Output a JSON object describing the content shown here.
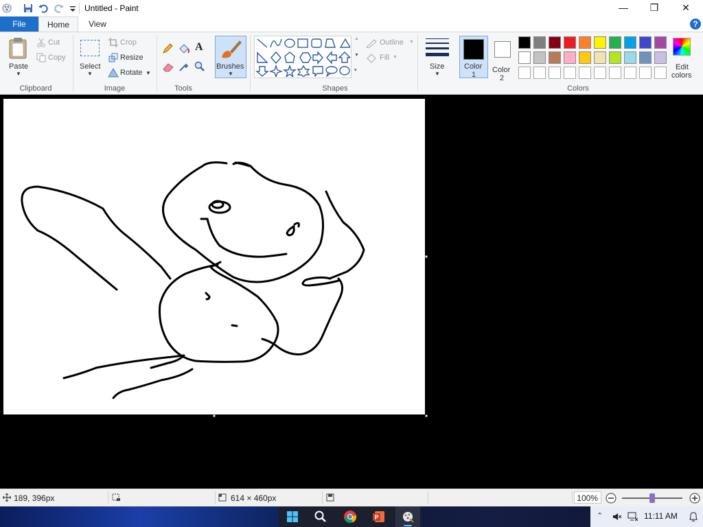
{
  "window": {
    "title": "Untitled - Paint",
    "controls": {
      "minimize": "—",
      "maximize": "❐",
      "close": "✕"
    }
  },
  "tabs": {
    "file": "File",
    "home": "Home",
    "view": "View"
  },
  "ribbon": {
    "clipboard": {
      "label": "Clipboard",
      "paste": "Paste",
      "cut": "Cut",
      "copy": "Copy"
    },
    "image": {
      "label": "Image",
      "select": "Select",
      "crop": "Crop",
      "resize": "Resize",
      "rotate": "Rotate"
    },
    "tools": {
      "label": "Tools",
      "text_glyph": "A"
    },
    "brushes": {
      "label": "Brushes"
    },
    "shapes": {
      "label": "Shapes",
      "outline": "Outline",
      "fill": "Fill"
    },
    "size": {
      "label": "Size"
    },
    "color1": {
      "label": "Color",
      "num": "1",
      "value": "#000000"
    },
    "color2": {
      "label": "Color",
      "num": "2",
      "value": "#ffffff"
    },
    "colors": {
      "label": "Colors",
      "edit_label_1": "Edit",
      "edit_label_2": "colors",
      "row1": [
        "#000000",
        "#7f7f7f",
        "#880015",
        "#ed1c24",
        "#ff7f27",
        "#fff200",
        "#22b14c",
        "#00a2e8",
        "#3f48cc",
        "#a349a4"
      ],
      "row2": [
        "#ffffff",
        "#c3c3c3",
        "#b97a57",
        "#ffaec9",
        "#ffc90e",
        "#efe4b0",
        "#b5e61d",
        "#99d9ea",
        "#7092be",
        "#c8bfe7"
      ],
      "row3": [
        "#ffffff",
        "#ffffff",
        "#ffffff",
        "#ffffff",
        "#ffffff",
        "#ffffff",
        "#ffffff",
        "#ffffff",
        "#ffffff",
        "#ffffff"
      ]
    },
    "help": "?"
  },
  "status": {
    "cursor_pos": "189, 396px",
    "canvas_size": "614 × 460px",
    "zoom": "100%",
    "zoom_fraction": 0.5
  },
  "taskbar": {
    "time": "11:11 AM"
  }
}
